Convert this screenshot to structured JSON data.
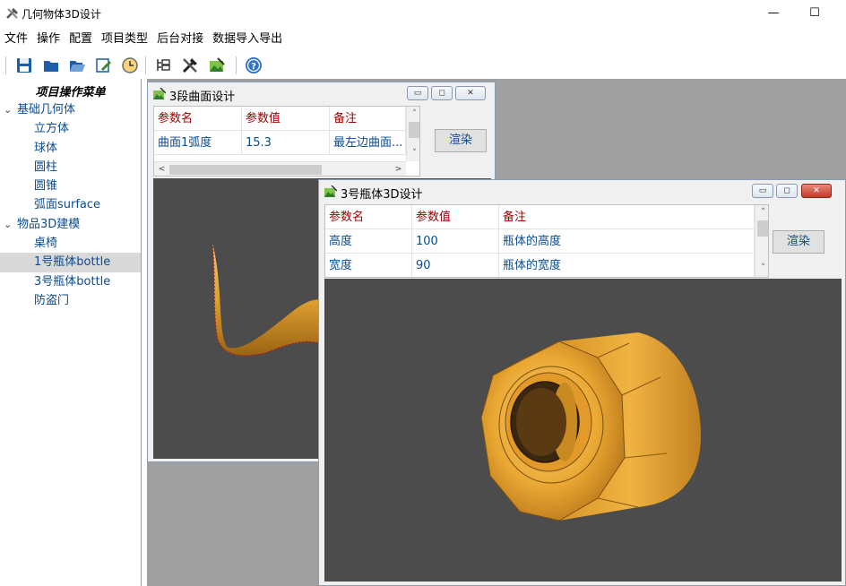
{
  "window": {
    "title": "几何物体3D设计",
    "minimize_glyph": "—",
    "maximize_glyph": "☐"
  },
  "menu": [
    "文件",
    "操作",
    "配置",
    "项目类型",
    "后台对接",
    "数据导入导出"
  ],
  "toolbar_icons": [
    "save-icon",
    "folder-closed-icon",
    "folder-open-icon",
    "edit-icon",
    "clock-icon",
    "tree-list-icon",
    "tools-icon",
    "image-tools-icon",
    "help-icon"
  ],
  "sidebar": {
    "title": "项目操作菜单",
    "groups": [
      {
        "label": "基础几何体",
        "items": [
          "立方体",
          "球体",
          "圆柱",
          "圆锥",
          "弧面surface"
        ]
      },
      {
        "label": "物品3D建模",
        "items": [
          "桌椅",
          "1号瓶体bottle",
          "3号瓶体bottle",
          "防盗门"
        ]
      }
    ],
    "selected": "1号瓶体bottle"
  },
  "window1": {
    "title": "3段曲面设计",
    "headers": [
      "参数名",
      "参数值",
      "备注"
    ],
    "rows": [
      [
        "曲面1弧度",
        "15.3",
        "最左边曲面..."
      ]
    ],
    "render_label": "渲染"
  },
  "window2": {
    "title": "3号瓶体3D设计",
    "headers": [
      "参数名",
      "参数值",
      "备注"
    ],
    "rows": [
      [
        "高度",
        "100",
        "瓶体的高度"
      ],
      [
        "宽度",
        "90",
        "瓶体的宽度"
      ]
    ],
    "render_label": "渲染"
  },
  "colors": {
    "header_text": "#a00000",
    "data_text": "#0b4b8f",
    "viewport_bg": "#4c4c4c",
    "model_gold": "#e8a62e",
    "mdi_bg": "#a0a0a0"
  },
  "glyphs": {
    "expand": "⌄",
    "up": "˄",
    "down": "˅",
    "left": "<",
    "right": ">",
    "min": "▭",
    "max": "◻",
    "close": "✕"
  }
}
